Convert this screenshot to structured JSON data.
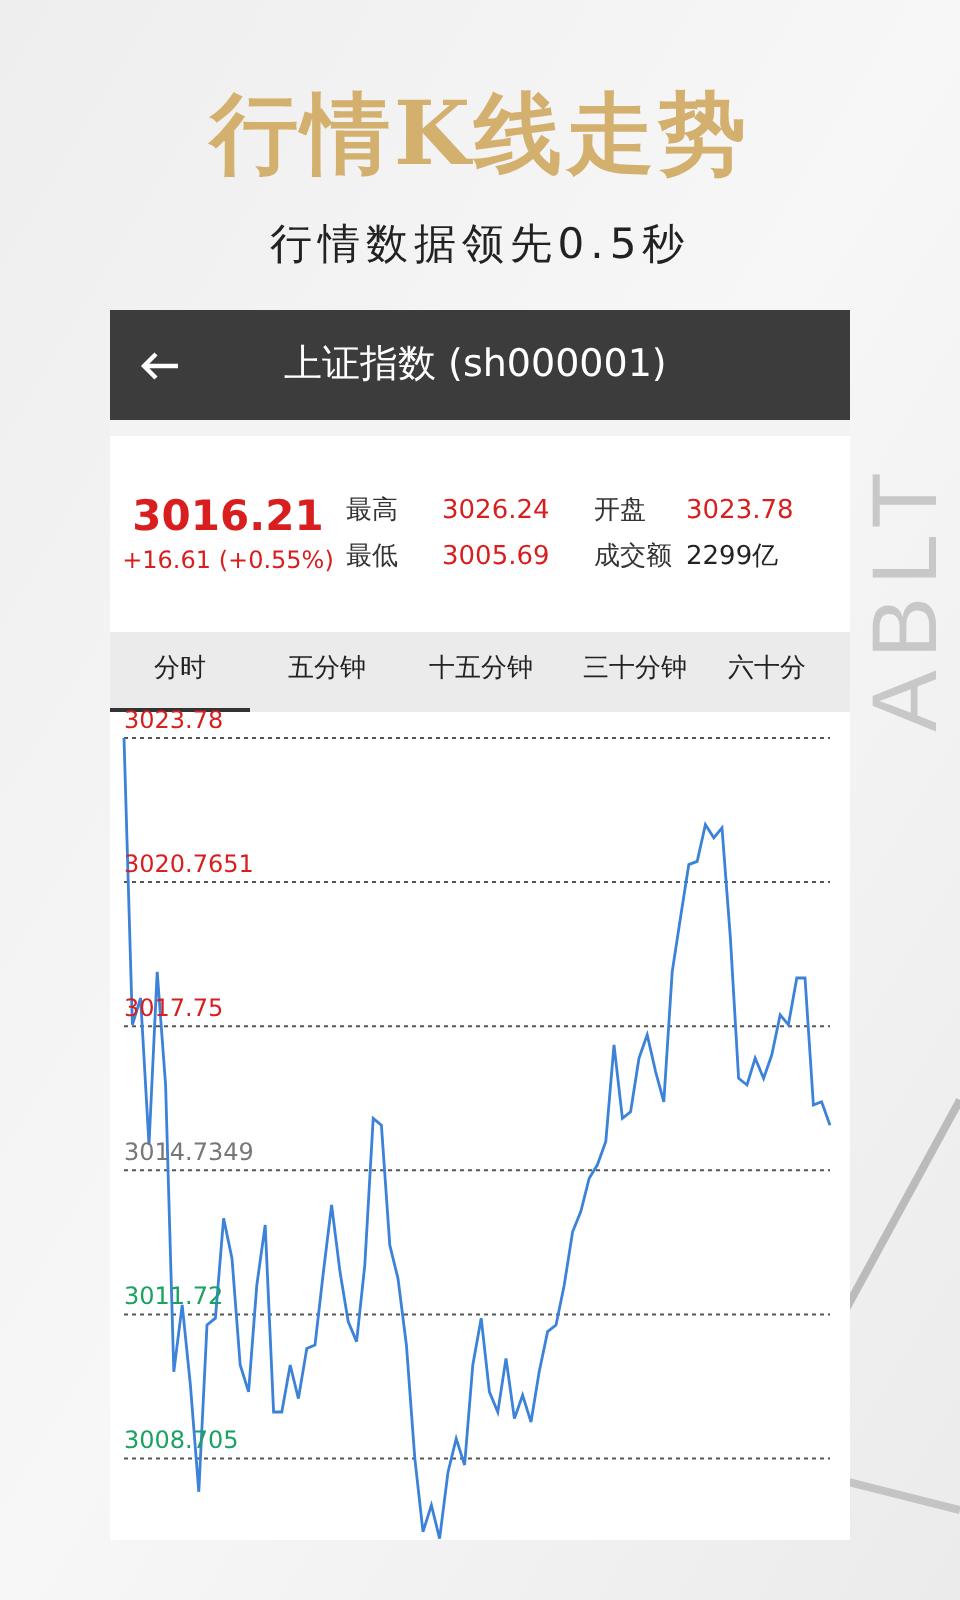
{
  "banner": {
    "title": "行情K线走势",
    "subtitle": "行情数据领先0.5秒",
    "side_text": "ABLT"
  },
  "header": {
    "title": "上证指数 (sh000001)"
  },
  "quote": {
    "price": "3016.21",
    "change": "+16.61 (+0.55%)",
    "stats": [
      {
        "label": "最高",
        "value": "3026.24",
        "color": "#d81e1e"
      },
      {
        "label": "最低",
        "value": "3005.69",
        "color": "#d81e1e"
      },
      {
        "label": "开盘",
        "value": "3023.78",
        "color": "#d81e1e"
      },
      {
        "label": "成交额",
        "value": "2299亿",
        "color": "#222222"
      }
    ]
  },
  "tabs": [
    {
      "label": "分时",
      "selected": true
    },
    {
      "label": "五分钟",
      "selected": false
    },
    {
      "label": "十五分钟",
      "selected": false
    },
    {
      "label": "三十分钟",
      "selected": false
    },
    {
      "label": "六十分",
      "selected": false
    }
  ],
  "chart_data": {
    "type": "line",
    "grid": true,
    "ylim": [
      3007.0,
      3023.78
    ],
    "yticks": [
      {
        "value": 3023.78,
        "label": "3023.78"
      },
      {
        "value": 3020.7651,
        "label": "3020.7651"
      },
      {
        "value": 3017.75,
        "label": "3017.75"
      },
      {
        "value": 3014.7349,
        "label": "3014.7349"
      },
      {
        "value": 3011.72,
        "label": "3011.72"
      },
      {
        "value": 3008.705,
        "label": "3008.705"
      }
    ],
    "series": [
      {
        "color": "#3b82d8",
        "values": [
          3023.78,
          3017.78,
          3018.34,
          3015.27,
          3018.89,
          3016.52,
          3010.52,
          3011.92,
          3010.24,
          3008.01,
          3011.5,
          3011.64,
          3013.73,
          3012.89,
          3010.66,
          3010.1,
          3012.33,
          3013.59,
          3009.68,
          3009.68,
          3010.66,
          3009.96,
          3011.01,
          3011.08,
          3012.61,
          3014.01,
          3012.61,
          3011.57,
          3011.15,
          3012.75,
          3015.82,
          3015.68,
          3013.17,
          3012.47,
          3011.08,
          3008.71,
          3007.17,
          3007.73,
          3007.03,
          3008.42,
          3009.12,
          3008.57,
          3010.66,
          3011.64,
          3010.1,
          3009.68,
          3010.8,
          3009.54,
          3010.03,
          3009.47,
          3010.52,
          3011.36,
          3011.5,
          3012.33,
          3013.45,
          3013.87,
          3014.57,
          3014.85,
          3015.34,
          3017.36,
          3015.82,
          3015.96,
          3017.08,
          3017.57,
          3016.8,
          3016.17,
          3018.89,
          3020.01,
          3021.13,
          3021.2,
          3021.97,
          3021.69,
          3021.9,
          3019.59,
          3016.66,
          3016.52,
          3017.08,
          3016.66,
          3017.15,
          3017.99,
          3017.78,
          3018.76,
          3018.76,
          3016.1,
          3016.17,
          3015.68
        ]
      }
    ]
  }
}
